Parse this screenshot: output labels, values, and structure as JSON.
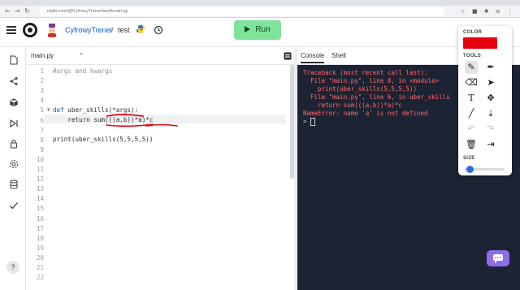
{
  "browser": {
    "url": "replit.com/@CyfrowyTrener/test#main.py",
    "nav_back": "←",
    "nav_forward": "→",
    "nav_reload": "↻",
    "extensions": "☆ ■ ✱ ≡ ⋮"
  },
  "header": {
    "username": "CyfrowyTrener",
    "separator": "/",
    "project": "test",
    "run_label": "Run"
  },
  "editor": {
    "tab_name": "main.py",
    "tab_close": "×",
    "line_numbers": [
      "1",
      "2",
      "3",
      "4",
      "5",
      "6",
      "7",
      "8",
      "9",
      "10",
      "11",
      "12",
      "13",
      "14",
      "15",
      "16",
      "17",
      "18",
      "19",
      "20",
      "21",
      "22"
    ],
    "lines": [
      {
        "text": "#args and kwargs",
        "kind": "comment"
      },
      {
        "text": "",
        "kind": "plain"
      },
      {
        "text": "",
        "kind": "plain"
      },
      {
        "text": "",
        "kind": "plain"
      },
      {
        "text": "def uber_skills(*args):",
        "kind": "def"
      },
      {
        "text": "    return sum(((a,b))*a)*c",
        "kind": "plain"
      },
      {
        "text": "",
        "kind": "plain"
      },
      {
        "text": "print(uber_skills(5,5,5,5))",
        "kind": "plain"
      }
    ],
    "fold_marker": "▾"
  },
  "console": {
    "tabs": [
      "Console",
      "Shell"
    ],
    "output": [
      "Traceback (most recent call last):",
      "  File \"main.py\", line 8, in <module>",
      "    print(uber_skills(5,5,5,5))",
      "  File \"main.py\", line 6, in uber_skills",
      "    return sum(((a,b))*a)*c",
      "NameError: name 'a' is not defined"
    ],
    "prompt": ">"
  },
  "annotation_panel": {
    "color_label": "COLOR",
    "tools_label": "TOOLS",
    "size_label": "SIZE",
    "color_value": "#e8020e",
    "size_level": 0.1
  },
  "colors": {
    "run_button": "#7ee49a",
    "console_bg": "#1c2333",
    "error_text": "#ff6b6b",
    "chat_button": "#8d6de8"
  }
}
